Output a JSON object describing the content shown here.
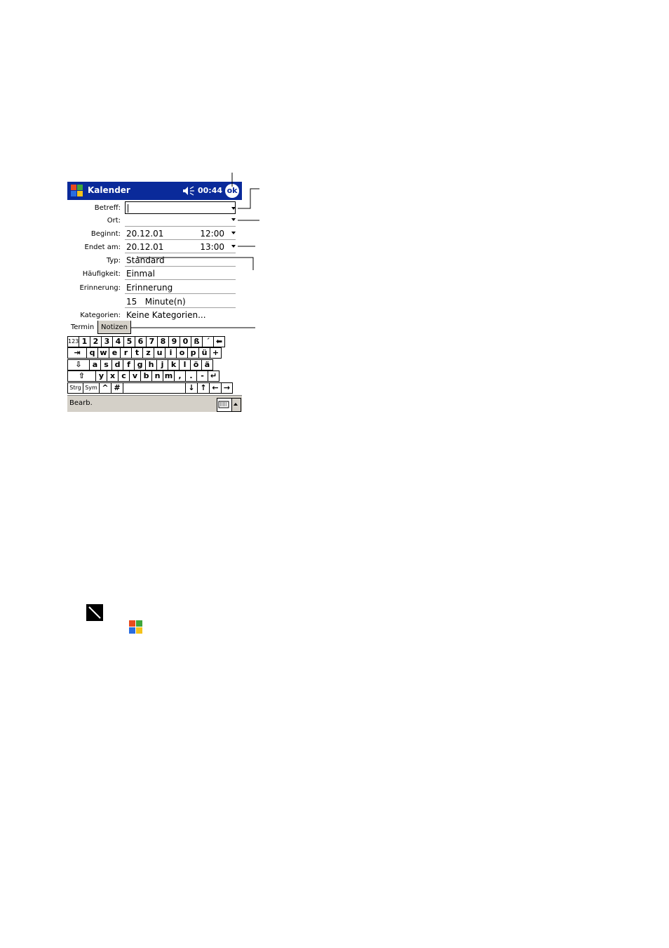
{
  "titlebar": {
    "app_title": "Kalender",
    "time": "00:44",
    "ok_label": "ok",
    "start_icon": "windows-flag-icon",
    "speaker_icon": "speaker-icon"
  },
  "form": {
    "betreff": {
      "label": "Betreff:",
      "value": ""
    },
    "ort": {
      "label": "Ort:",
      "value": ""
    },
    "beginnt": {
      "label": "Beginnt:",
      "date": "20.12.01",
      "time": "12:00"
    },
    "endet": {
      "label": "Endet am:",
      "date": "20.12.01",
      "time": "13:00"
    },
    "typ": {
      "label": "Typ:",
      "value": "Standard"
    },
    "haeufigkeit": {
      "label": "Häufigkeit:",
      "value": "Einmal"
    },
    "erinnerung": {
      "label": "Erinnerung:",
      "value": "Erinnerung"
    },
    "erinnerung_zeit": {
      "value": "15   Minute(n)"
    },
    "kategorien": {
      "label": "Kategorien:",
      "value": "Keine Kategorien..."
    }
  },
  "tabs": {
    "termin": "Termin",
    "notizen": "Notizen"
  },
  "keyboard": {
    "row1": [
      "123",
      "1",
      "2",
      "3",
      "4",
      "5",
      "6",
      "7",
      "8",
      "9",
      "0",
      "ß",
      "´",
      "⬅"
    ],
    "row2": [
      "⇥",
      "q",
      "w",
      "e",
      "r",
      "t",
      "z",
      "u",
      "i",
      "o",
      "p",
      "ü",
      "+"
    ],
    "row3": [
      "⇩",
      "a",
      "s",
      "d",
      "f",
      "g",
      "h",
      "j",
      "k",
      "l",
      "ö",
      "ä"
    ],
    "row4": [
      "⇧",
      "y",
      "x",
      "c",
      "v",
      "b",
      "n",
      "m",
      ",",
      ".",
      "-",
      "↵"
    ],
    "row5": [
      "Strg",
      "Sym",
      "^",
      "#",
      " ",
      "↓",
      "↑",
      "←",
      "→"
    ]
  },
  "menubar": {
    "label": "Bearb.",
    "sip_icon": "keyboard-icon"
  },
  "extra_icons": [
    "pen-icon",
    "windows-flag-icon"
  ],
  "colors": {
    "titlebar": "#0a2a9a",
    "menubar": "#d4d0c8"
  }
}
